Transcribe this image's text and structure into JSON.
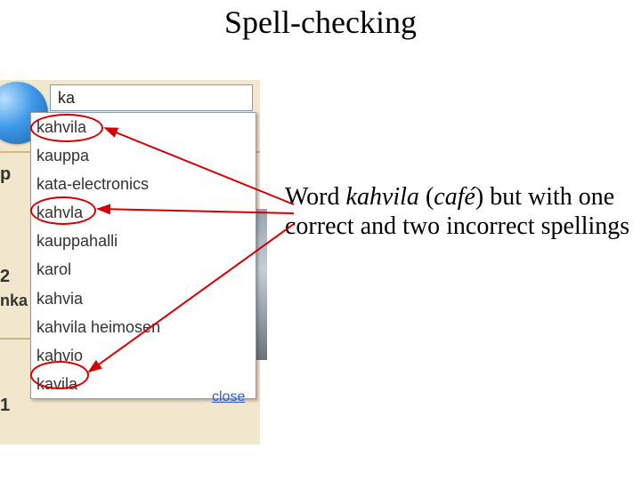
{
  "title": "Spell-checking",
  "search": {
    "value": "ka"
  },
  "suggestions": {
    "items": [
      "kahvila",
      "kauppa",
      "kata-electronics",
      "kahvla",
      "kauppahalli",
      "karol",
      "kahvia",
      "kahvila heimosen",
      "kahvio",
      "kavila"
    ],
    "close_label": "close"
  },
  "map_fragments": {
    "p": "p",
    "two": "2",
    "nka": "nka",
    "one": "1"
  },
  "caption": {
    "pre": "Word ",
    "word": "kahvila",
    "paren_open": " (",
    "translation": "café",
    "paren_close": ") but with one correct and two incorrect spellings"
  },
  "annotations": {
    "highlighted_indices": [
      0,
      3,
      9
    ],
    "colors": {
      "ellipse": "#d30000",
      "arrow": "#d30000"
    }
  }
}
